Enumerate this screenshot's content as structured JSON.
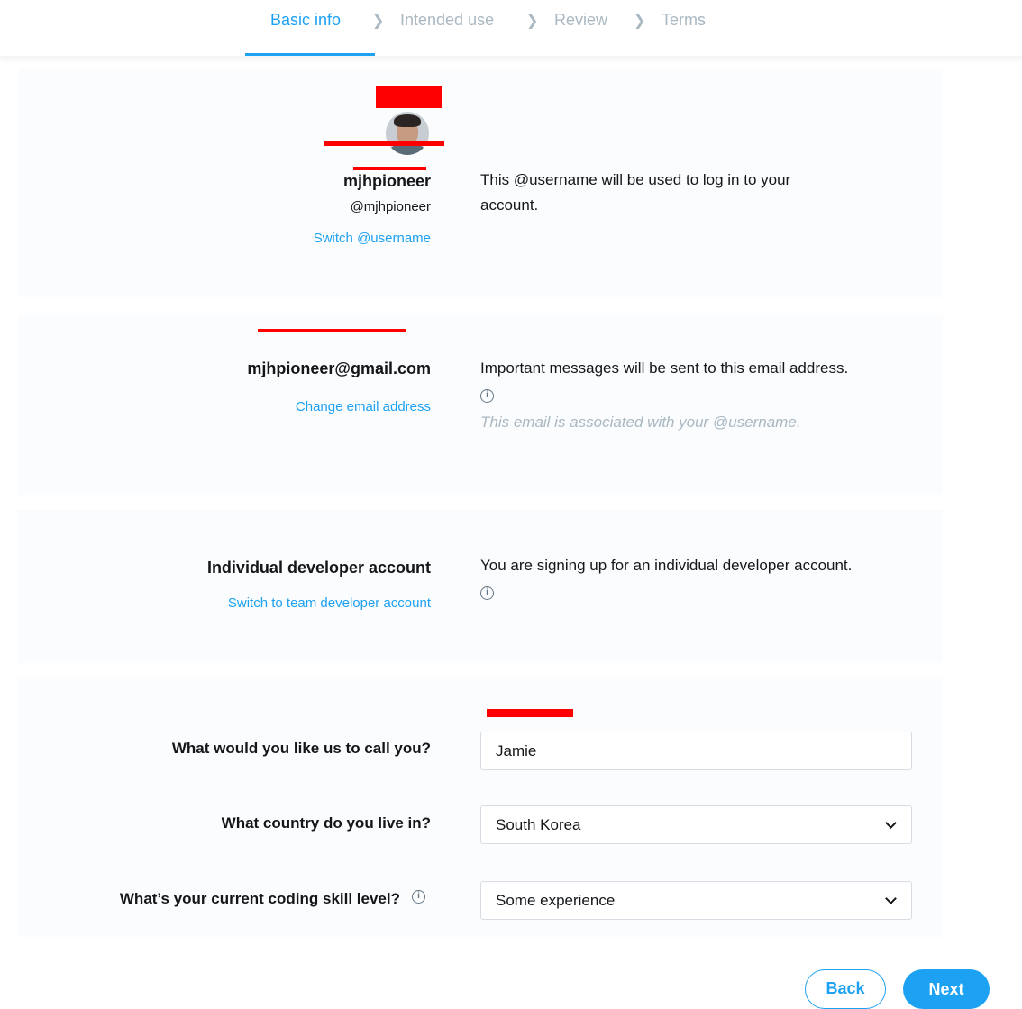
{
  "stepper": {
    "steps": [
      {
        "label": "Basic info",
        "active": true
      },
      {
        "label": "Intended use",
        "active": false
      },
      {
        "label": "Review",
        "active": false
      },
      {
        "label": "Terms",
        "active": false
      }
    ],
    "separator_icon": "chevron-right-icon"
  },
  "account": {
    "avatar_icon": "user-avatar",
    "display_name": "mjhpioneer",
    "handle": "@mjhpioneer",
    "switch_link": "Switch @username",
    "description": "This @username will be used to log in to your account."
  },
  "email": {
    "address": "mjhpioneer@gmail.com",
    "change_link": "Change email address",
    "description": "Important messages will be sent to this email address.",
    "info_icon": "info-icon",
    "note": "This email is associated with your @username."
  },
  "account_type": {
    "title": "Individual developer account",
    "switch_link": "Switch to team developer account",
    "description": "You are signing up for an individual developer account."
  },
  "form": {
    "name_label": "What would you like us to call you?",
    "name_value": "Jamie",
    "country_label": "What country do you live in?",
    "country_value": "South Korea",
    "skill_label": "What’s your current coding skill level?",
    "skill_value": "Some experience"
  },
  "buttons": {
    "back": "Back",
    "next": "Next"
  },
  "colors": {
    "accent": "#1da1f2",
    "muted": "#aab8c2",
    "redaction": "#ff0000"
  }
}
